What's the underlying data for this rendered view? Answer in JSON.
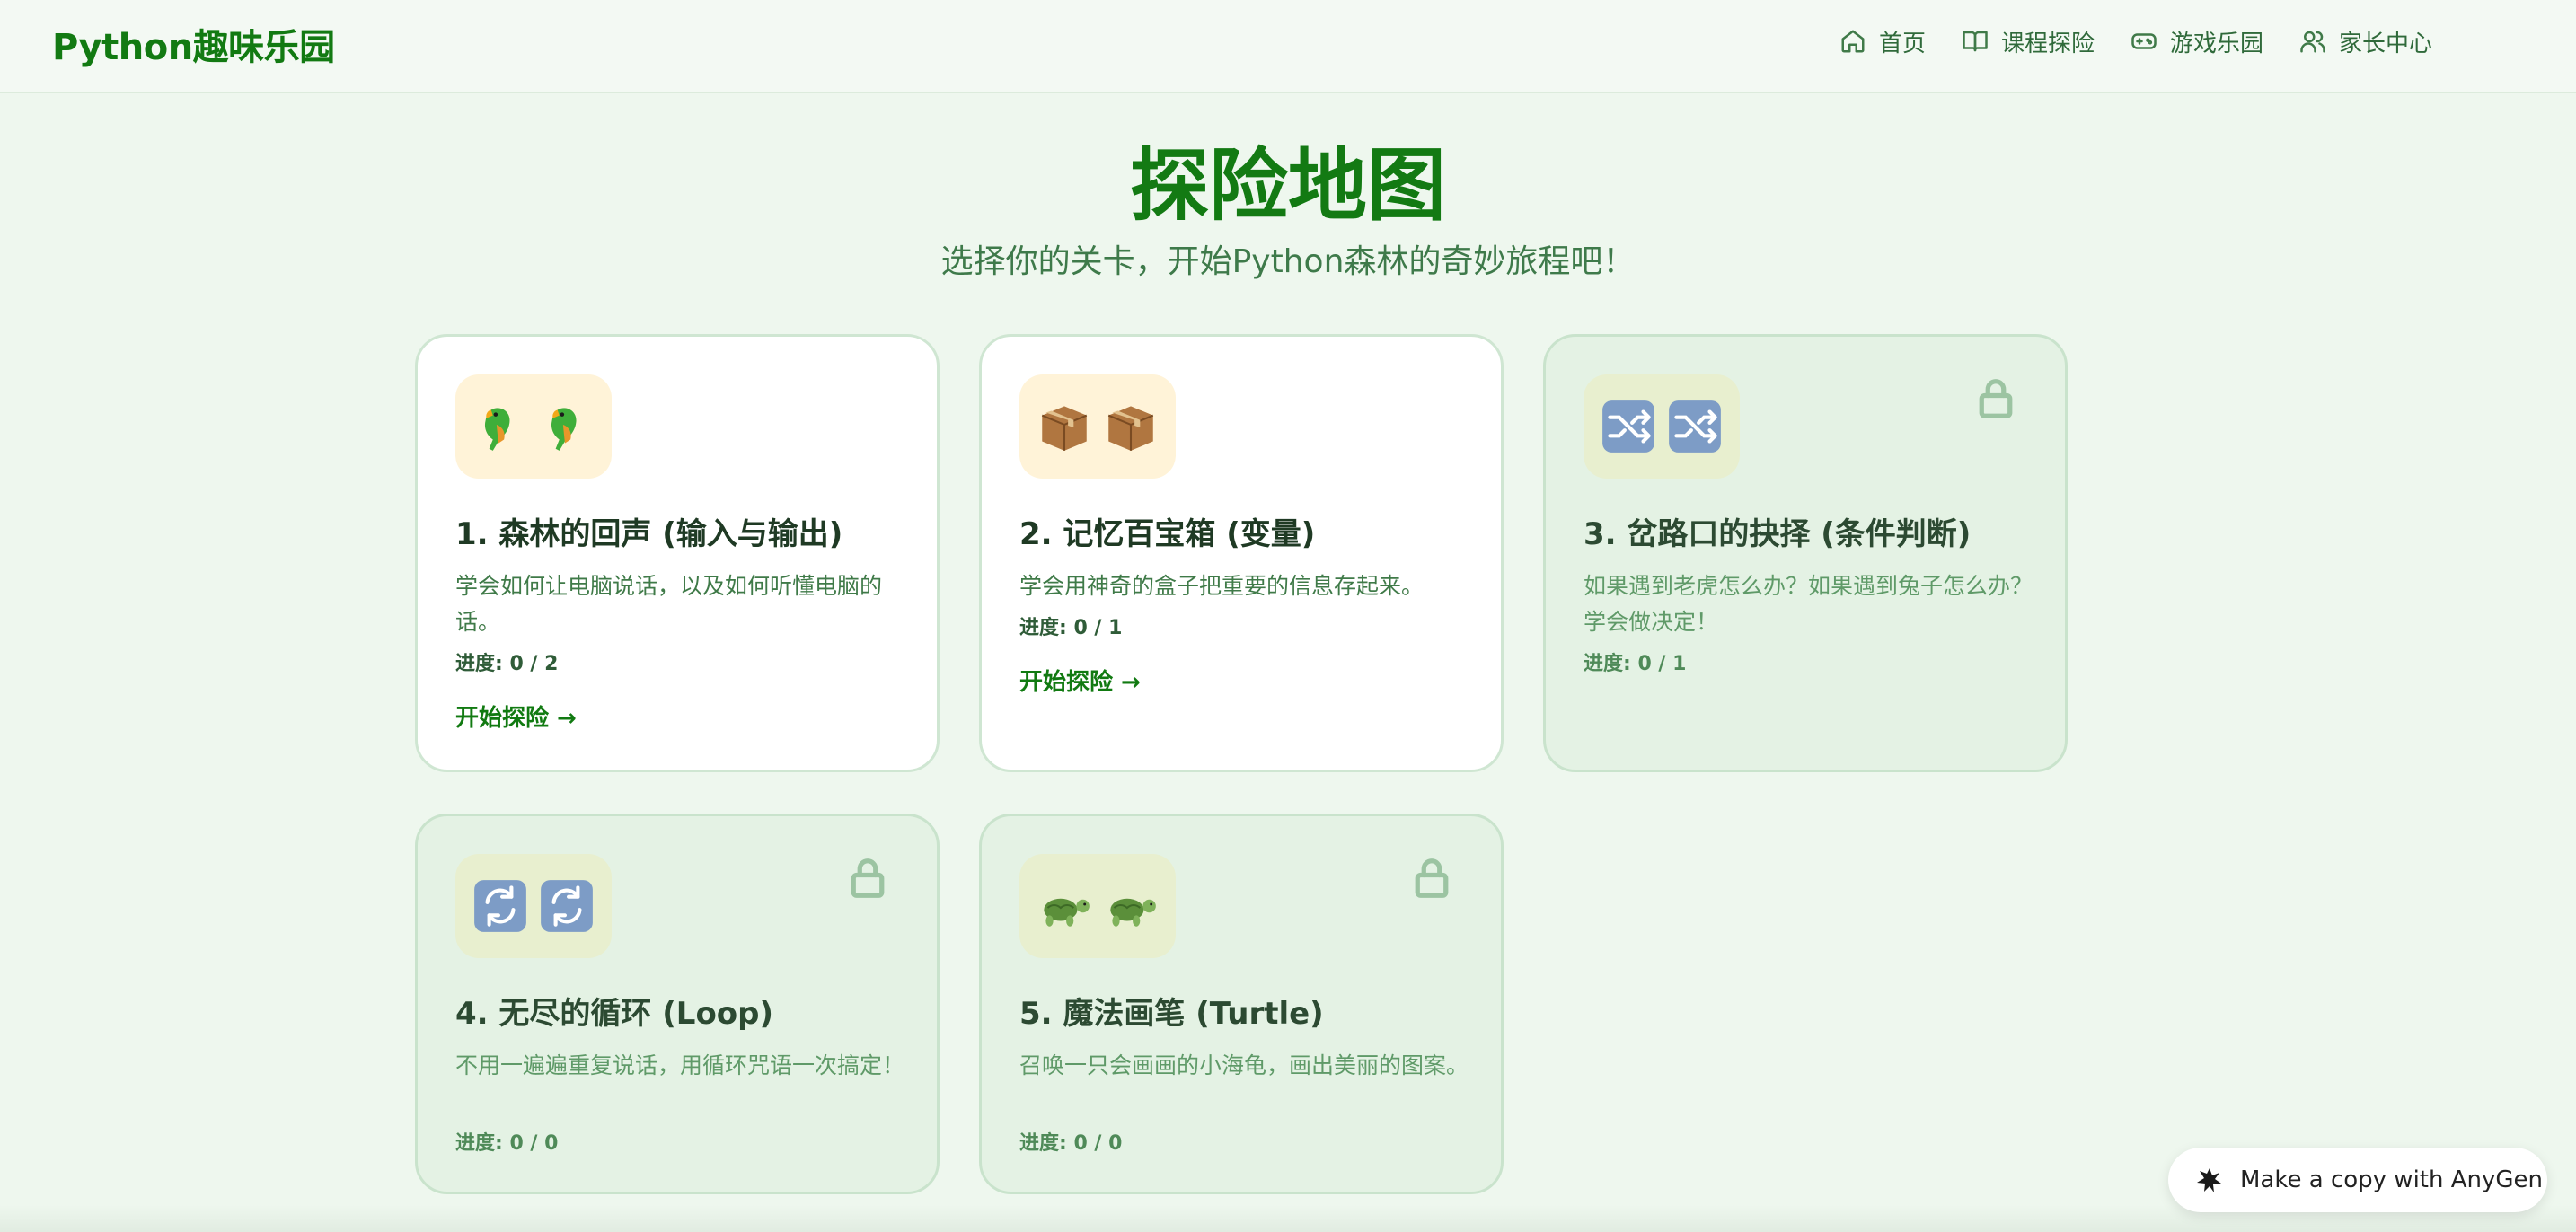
{
  "header": {
    "logo": "Python趣味乐园",
    "nav": [
      {
        "label": "首页",
        "icon": "home-icon"
      },
      {
        "label": "课程探险",
        "icon": "book-icon"
      },
      {
        "label": "游戏乐园",
        "icon": "gamepad-icon"
      },
      {
        "label": "家长中心",
        "icon": "users-icon"
      }
    ]
  },
  "hero": {
    "title": "探险地图",
    "subtitle": "选择你的关卡，开始Python森林的奇妙旅程吧！"
  },
  "levels": [
    {
      "title": "1. 森林的回声 (输入与输出)",
      "desc": "学会如何让电脑说话，以及如何听懂电脑的话。",
      "progress": "进度: 0 / 2",
      "cta": "开始探险 →",
      "icon": "parrot-icon",
      "locked": false
    },
    {
      "title": "2. 记忆百宝箱 (变量)",
      "desc": "学会用神奇的盒子把重要的信息存起来。",
      "progress": "进度: 0 / 1",
      "cta": "开始探险 →",
      "icon": "package-icon",
      "locked": false
    },
    {
      "title": "3. 岔路口的抉择 (条件判断)",
      "desc": "如果遇到老虎怎么办？如果遇到兔子怎么办？学会做决定！",
      "progress": "进度: 0 / 1",
      "icon": "shuffle-icon",
      "locked": true
    },
    {
      "title": "4. 无尽的循环 (Loop)",
      "desc": "不用一遍遍重复说话，用循环咒语一次搞定！",
      "progress": "进度: 0 / 0",
      "icon": "repeat-icon",
      "locked": true
    },
    {
      "title": "5. 魔法画笔 (Turtle)",
      "desc": "召唤一只会画画的小海龟，画出美丽的图案。",
      "progress": "进度: 0 / 0",
      "icon": "turtle-icon",
      "locked": true
    }
  ],
  "floating": {
    "label": "Make a copy with AnyGen",
    "icon": "anygen-logo-icon"
  },
  "colors": {
    "accent": "#137a13",
    "card_locked": "#e4f2e4",
    "background": "#eef7ee"
  }
}
